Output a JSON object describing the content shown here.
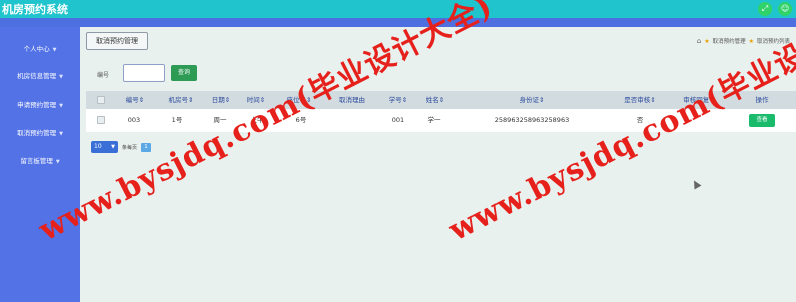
{
  "header": {
    "title": "机房预约系统",
    "icons": [
      "expand-icon",
      "user-icon"
    ]
  },
  "sidebar": {
    "items": [
      {
        "label": "个人中心"
      },
      {
        "label": "机房信息管理"
      },
      {
        "label": "申请预约管理"
      },
      {
        "label": "取消预约管理"
      },
      {
        "label": "留言板管理"
      }
    ]
  },
  "main": {
    "header_button": "取消预约管理",
    "breadcrumb": [
      "取消预约管理",
      "取消预约列表"
    ],
    "search": {
      "label": "编号",
      "value": "",
      "button": "查询"
    },
    "table": {
      "columns": [
        "编号",
        "机房号",
        "日期",
        "时间",
        "座位号",
        "取消理由",
        "学号",
        "姓名",
        "身份证",
        "是否审核",
        "审核回复",
        "操作"
      ],
      "rows": [
        {
          "cells": [
            "003",
            "1号",
            "周一",
            "上午",
            "6号",
            "",
            "001",
            "学一",
            "258963258963258963",
            "否",
            "",
            ""
          ],
          "action": "查看"
        }
      ]
    },
    "pager": {
      "page_size": "10",
      "per_page_label": "条每页",
      "current_page": "1"
    }
  },
  "watermark": {
    "text1": "www.bysjdq.com(毕业设计大全)",
    "text2": "www.bysjdq.com(毕业设计大全)"
  }
}
